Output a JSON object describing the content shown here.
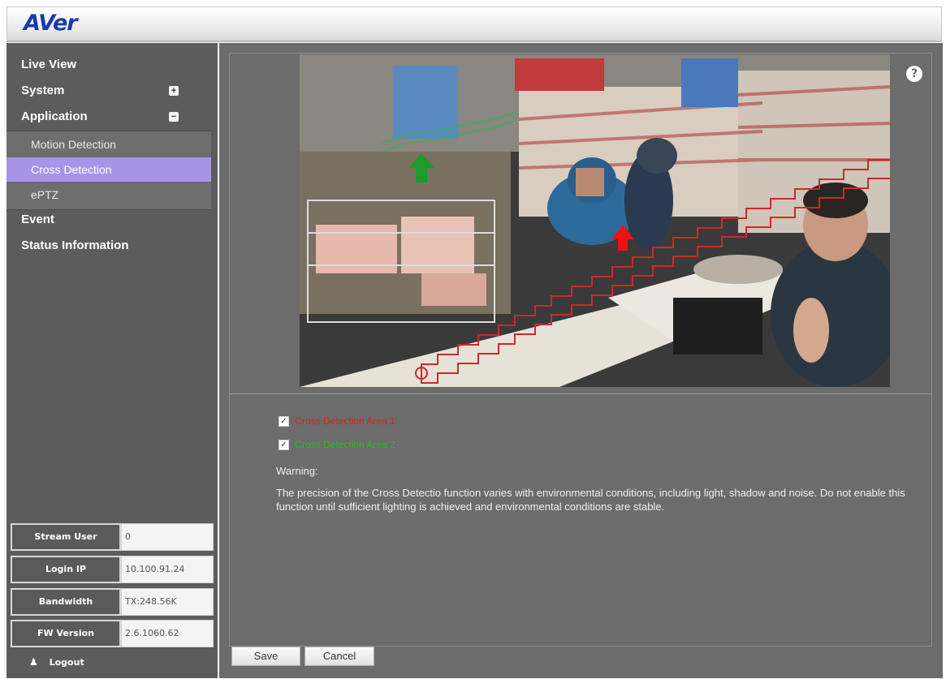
{
  "header": {
    "logo_main": "AVer",
    "brand_color": "#1a3aa8",
    "dot_color": "#d21f2f"
  },
  "sidebar": {
    "nav": [
      {
        "label": "Live View",
        "toggle": ""
      },
      {
        "label": "System",
        "toggle": "+"
      },
      {
        "label": "Application",
        "toggle": "−"
      },
      {
        "label": "Event",
        "toggle": ""
      },
      {
        "label": "Status Information",
        "toggle": ""
      }
    ],
    "subnav": [
      {
        "label": "Motion Detection",
        "active": false
      },
      {
        "label": "Cross Detection",
        "active": true
      },
      {
        "label": "ePTZ",
        "active": false
      }
    ],
    "active_color": "#a794e8",
    "info": [
      {
        "label": "Stream User",
        "value": "0"
      },
      {
        "label": "Login IP",
        "value": "10.100.91.24"
      },
      {
        "label": "Bandwidth",
        "value": "TX:248.56K"
      },
      {
        "label": "FW Version",
        "value": "2.6.1060.62"
      }
    ],
    "logout_label": "Logout"
  },
  "main": {
    "help_icon": "help-icon",
    "areas": [
      {
        "label": "Cross Detection Area 1",
        "checked": true,
        "color": "#e02020"
      },
      {
        "label": "Cross Detection Area 2",
        "checked": true,
        "color": "#20c020"
      }
    ],
    "warning_title": "Warning:",
    "warning_text": "The precision of the Cross Detectio function varies with environmental conditions, including light, shadow and noise. Do not enable this function until sufficient lighting is achieved and environmental conditions are stable.",
    "save_label": "Save",
    "cancel_label": "Cancel"
  }
}
